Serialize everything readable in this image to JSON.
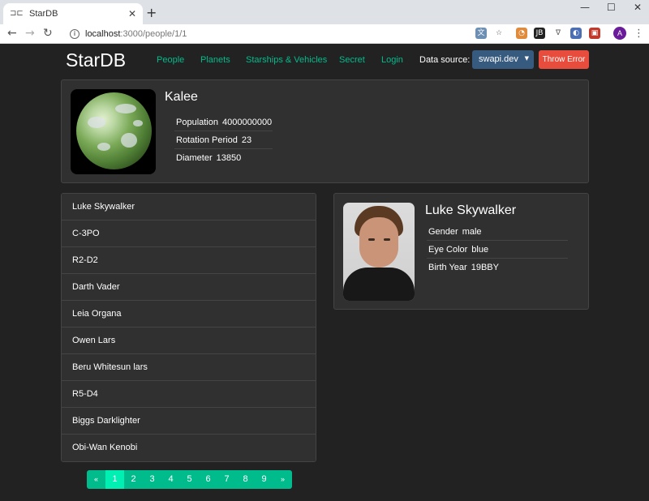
{
  "browser": {
    "tab_title": "StarDB",
    "url_host": "localhost",
    "url_path": ":3000/people/1/1",
    "avatar_letter": "A"
  },
  "header": {
    "logo": "StarDB",
    "nav": [
      "People",
      "Planets",
      "Starships & Vehicles",
      "Secret",
      "Login"
    ],
    "data_source_label": "Data source:",
    "data_source_value": "swapi.dev",
    "throw_error_label": "Throw Error"
  },
  "planet": {
    "name": "Kalee",
    "details": [
      {
        "term": "Population",
        "value": "4000000000"
      },
      {
        "term": "Rotation Period",
        "value": "23"
      },
      {
        "term": "Diameter",
        "value": "13850"
      }
    ]
  },
  "people_list": [
    "Luke Skywalker",
    "C-3PO",
    "R2-D2",
    "Darth Vader",
    "Leia Organa",
    "Owen Lars",
    "Beru Whitesun lars",
    "R5-D4",
    "Biggs Darklighter",
    "Obi-Wan Kenobi"
  ],
  "person": {
    "name": "Luke Skywalker",
    "details": [
      {
        "term": "Gender",
        "value": "male"
      },
      {
        "term": "Eye Color",
        "value": "blue"
      },
      {
        "term": "Birth Year",
        "value": "19BBY"
      }
    ]
  },
  "pagination": {
    "prev": "«",
    "pages": [
      "1",
      "2",
      "3",
      "4",
      "5",
      "6",
      "7",
      "8",
      "9"
    ],
    "next": "»",
    "active_page": "1"
  },
  "colors": {
    "background": "#222222",
    "card": "#303030",
    "accent": "#00bc8c",
    "select": "#375a7f",
    "danger": "#e74c3c"
  }
}
